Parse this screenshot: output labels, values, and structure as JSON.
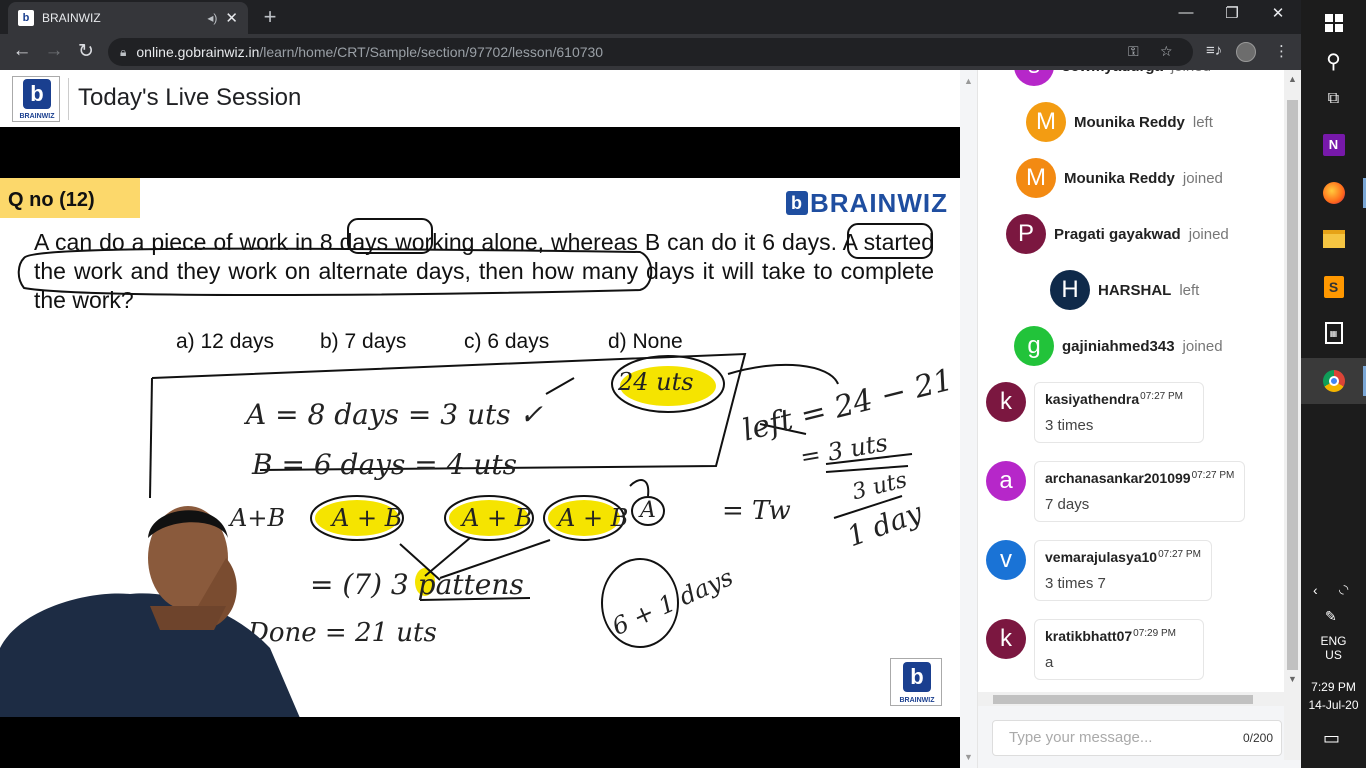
{
  "browser": {
    "tab_title": "BRAINWIZ",
    "tab_favicon": "b",
    "url_domain": "online.gobrainwiz.in",
    "url_path": "/learn/home/CRT/Sample/section/97702/lesson/610730"
  },
  "page": {
    "title": "Today's Live Session",
    "logo_text": "BRAINWIZ"
  },
  "slide": {
    "qno": "Q no (12)",
    "brand": "BRAINWIZ",
    "question": "A can do a piece of work in 8 days working alone, whereas B can do it 6 days. A started the work and they work on alternate days, then how many days it will take to complete the work?",
    "options": [
      "a) 12 days",
      "b) 7 days",
      "c) 6 days",
      "d) None"
    ],
    "hand_24": "24 uts",
    "hand_a": "A = 8 days = 3 uts ✓",
    "hand_b": "B = 6 days = 4 uts",
    "hand_left": "left = 24 − 21",
    "hand_eq3": "= 3 uts",
    "hand_3uts": "3 uts",
    "hand_1day": "1 day",
    "hand_ab1": "A + B",
    "hand_ab2": "A + B",
    "hand_ab3": "A + B",
    "hand_a_circ": "A",
    "hand_tw": "= Tw",
    "hand_7": "= (7) 3 pattens",
    "hand_done": "Done = 21 uts",
    "hand_6days": "6 + 1 days",
    "hand_apb": "A+B"
  },
  "chat": {
    "events": [
      {
        "name": "sowmyadurga",
        "action": "joined",
        "initial": "s",
        "color": "#b627c9"
      },
      {
        "name": "Mounika Reddy",
        "action": "left",
        "initial": "M",
        "color": "#f39c12"
      },
      {
        "name": "Mounika Reddy",
        "action": "joined",
        "initial": "M",
        "color": "#f38a12"
      },
      {
        "name": "Pragati gayakwad",
        "action": "joined",
        "initial": "P",
        "color": "#7b1740"
      },
      {
        "name": "HARSHAL",
        "action": "left",
        "initial": "H",
        "color": "#0f2a4a"
      },
      {
        "name": "gajiniahmed343",
        "action": "joined",
        "initial": "g",
        "color": "#22c33a"
      }
    ],
    "messages": [
      {
        "name": "kasiyathendra",
        "time": "07:27 PM",
        "text": "3 times",
        "initial": "k",
        "color": "#7b1740"
      },
      {
        "name": "archanasankar201099",
        "time": "07:27 PM",
        "text": "7 days",
        "initial": "a",
        "color": "#b627c9"
      },
      {
        "name": "vemarajulasya10",
        "time": "07:27 PM",
        "text": "3 times 7",
        "initial": "v",
        "color": "#1a73d6"
      },
      {
        "name": "kratikbhatt07",
        "time": "07:29 PM",
        "text": "a",
        "initial": "k",
        "color": "#7b1740"
      }
    ],
    "input_placeholder": "Type your message...",
    "char_count": "0/200"
  },
  "taskbar": {
    "lang1": "ENG",
    "lang2": "US",
    "time": "7:29 PM",
    "date": "14-Jul-20"
  },
  "colors": {
    "accent_brand": "#1a3f8f",
    "highlight_yellow": "#f5e400"
  }
}
